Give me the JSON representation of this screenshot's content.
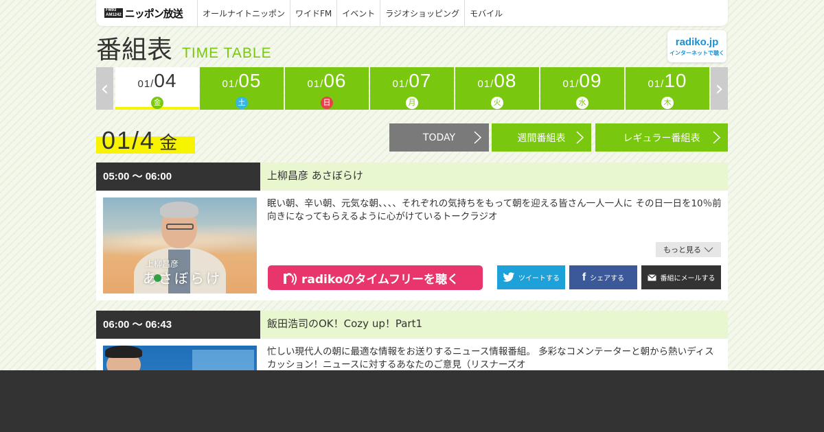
{
  "nav": {
    "logo_mark_top": "FM93",
    "logo_mark_bottom": "AM1242",
    "logo_text": "ニッポン放送",
    "items": [
      "オールナイトニッポン",
      "ワイドFM",
      "イベント",
      "ラジオショッピング",
      "モバイル"
    ]
  },
  "title": {
    "ja": "番組表",
    "en": "TIME TABLE"
  },
  "radiko_badge": {
    "main": "radiko.jp",
    "sub": "インターネットで聴く"
  },
  "dates": [
    {
      "month": "01/",
      "day": "04",
      "dow": "金",
      "type": "weekday",
      "active": true
    },
    {
      "month": "01/",
      "day": "05",
      "dow": "土",
      "type": "sat",
      "active": false
    },
    {
      "month": "01/",
      "day": "06",
      "dow": "日",
      "type": "sun",
      "active": false
    },
    {
      "month": "01/",
      "day": "07",
      "dow": "月",
      "type": "weekday",
      "active": false
    },
    {
      "month": "01/",
      "day": "08",
      "dow": "火",
      "type": "weekday",
      "active": false
    },
    {
      "month": "01/",
      "day": "09",
      "dow": "水",
      "type": "weekday",
      "active": false
    },
    {
      "month": "01/",
      "day": "10",
      "dow": "木",
      "type": "weekday",
      "active": false
    }
  ],
  "arrows": {
    "prev": "‹",
    "next": "›"
  },
  "current_date": {
    "date": "01/4",
    "dow": "金"
  },
  "buttons": {
    "today": "TODAY",
    "weekly": "週間番組表",
    "regular": "レギュラー番組表"
  },
  "programs": [
    {
      "time": "05:00 ～ 06:00",
      "title": "上柳昌彦 あさぼらけ",
      "description": "眠い朝、辛い朝、元気な朝、、、、それぞれの気持ちをもって朝を迎える皆さん一人一人に その日一日を10％前向きになってもらえるように心がけているトークラジオ",
      "thumb_caption_small": "上柳昌彦",
      "thumb_caption_large": "あさぼらけ",
      "more": "もっと見る",
      "radiko": "radikoのタイムフリーを聴く",
      "tweet": "ツイートする",
      "share": "シェアする",
      "mail": "番組にメールする"
    },
    {
      "time": "06:00 ～ 06:43",
      "title": "飯田浩司のOK！Cozy up！Part1",
      "description": "忙しい現代人の朝に最適な情報をお送りするニュース情報番組。 多彩なコメンテーターと朝から熱いディスカッション！ニュースに対するあなたのご意見（リスナーズオ"
    }
  ],
  "colors": {
    "green": "#7ac70f",
    "yellow": "#f8f400",
    "dark": "#333333",
    "radiko_pink": "#e8356b",
    "twitter": "#1da1d8",
    "facebook": "#3b5898"
  }
}
